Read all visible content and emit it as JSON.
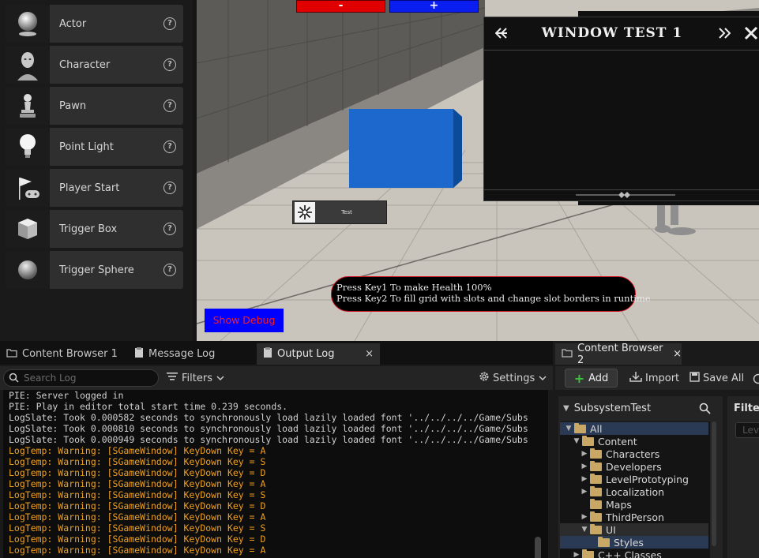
{
  "place_actors": {
    "items": [
      {
        "label": "Actor",
        "icon": "sphere-icon"
      },
      {
        "label": "Character",
        "icon": "mannequin-icon"
      },
      {
        "label": "Pawn",
        "icon": "pawn-icon"
      },
      {
        "label": "Point Light",
        "icon": "light-bulb-icon"
      },
      {
        "label": "Player Start",
        "icon": "flag-gamepad-icon"
      },
      {
        "label": "Trigger Box",
        "icon": "box-icon"
      },
      {
        "label": "Trigger Sphere",
        "icon": "sphere-icon"
      }
    ],
    "help_glyph": "?"
  },
  "viewport": {
    "minus_label": "-",
    "plus_label": "+",
    "test_widget_label": "Test",
    "banner_line1": "Press Key1 To make Health 100%",
    "banner_line2": "Press Key2 To fill grid with slots and change slot borders in runtime",
    "show_debug_label": "Show Debug",
    "window_title": "WINDOW TEST 1",
    "colors": {
      "minus": "#e00000",
      "plus": "#0a1ef0",
      "debug_bg": "#0000ff",
      "debug_text": "#ff1a1a",
      "banner_border": "#d01020",
      "cube": "#1563c8"
    }
  },
  "bottom_tabs": {
    "content_browser_1": "Content Browser 1",
    "message_log": "Message Log",
    "output_log": "Output Log",
    "close_glyph": "×"
  },
  "log_toolbar": {
    "search_placeholder": "Search Log",
    "filters_label": "Filters",
    "settings_label": "Settings"
  },
  "log_lines": [
    {
      "text": "PIE: Server logged in",
      "level": "info"
    },
    {
      "text": "PIE: Play in editor total start time 0.239 seconds.",
      "level": "info"
    },
    {
      "text": "LogSlate: Took 0.000582 seconds to synchronously load lazily loaded font '../../../../Game/Subs",
      "level": "info"
    },
    {
      "text": "LogSlate: Took 0.000810 seconds to synchronously load lazily loaded font '../../../../Game/Subs",
      "level": "info"
    },
    {
      "text": "LogSlate: Took 0.000949 seconds to synchronously load lazily loaded font '../../../../Game/Subs",
      "level": "info"
    },
    {
      "text": "LogTemp: Warning: [SGameWindow] KeyDown Key = A",
      "level": "warning"
    },
    {
      "text": "LogTemp: Warning: [SGameWindow] KeyDown Key = S",
      "level": "warning"
    },
    {
      "text": "LogTemp: Warning: [SGameWindow] KeyDown Key = D",
      "level": "warning"
    },
    {
      "text": "LogTemp: Warning: [SGameWindow] KeyDown Key = A",
      "level": "warning"
    },
    {
      "text": "LogTemp: Warning: [SGameWindow] KeyDown Key = S",
      "level": "warning"
    },
    {
      "text": "LogTemp: Warning: [SGameWindow] KeyDown Key = D",
      "level": "warning"
    },
    {
      "text": "LogTemp: Warning: [SGameWindow] KeyDown Key = A",
      "level": "warning"
    },
    {
      "text": "LogTemp: Warning: [SGameWindow] KeyDown Key = S",
      "level": "warning"
    },
    {
      "text": "LogTemp: Warning: [SGameWindow] KeyDown Key = D",
      "level": "warning"
    },
    {
      "text": "LogTemp: Warning: [SGameWindow] KeyDown Key = A",
      "level": "warning"
    }
  ],
  "content_browser_2": {
    "tab_label": "Content Browser 2",
    "close_glyph": "×",
    "add_label": "Add",
    "import_label": "Import",
    "save_all_label": "Save All",
    "tree_title": "SubsystemTest",
    "filters_label": "Filters",
    "filters_input_placeholder": "Lev",
    "tree": [
      {
        "label": "All",
        "depth": 0,
        "expanded": true,
        "selected": true
      },
      {
        "label": "Content",
        "depth": 1,
        "expanded": true,
        "selected": false
      },
      {
        "label": "Characters",
        "depth": 2,
        "expanded": false,
        "selected": false
      },
      {
        "label": "Developers",
        "depth": 2,
        "expanded": false,
        "selected": false
      },
      {
        "label": "LevelPrototyping",
        "depth": 2,
        "expanded": false,
        "selected": false
      },
      {
        "label": "Localization",
        "depth": 2,
        "expanded": false,
        "selected": false
      },
      {
        "label": "Maps",
        "depth": 2,
        "expanded": null,
        "selected": false
      },
      {
        "label": "ThirdPerson",
        "depth": 2,
        "expanded": false,
        "selected": false
      },
      {
        "label": "UI",
        "depth": 2,
        "expanded": true,
        "selected": true
      },
      {
        "label": "Styles",
        "depth": 3,
        "expanded": null,
        "selected": true
      },
      {
        "label": "C++ Classes",
        "depth": 1,
        "expanded": false,
        "selected": false
      }
    ]
  }
}
